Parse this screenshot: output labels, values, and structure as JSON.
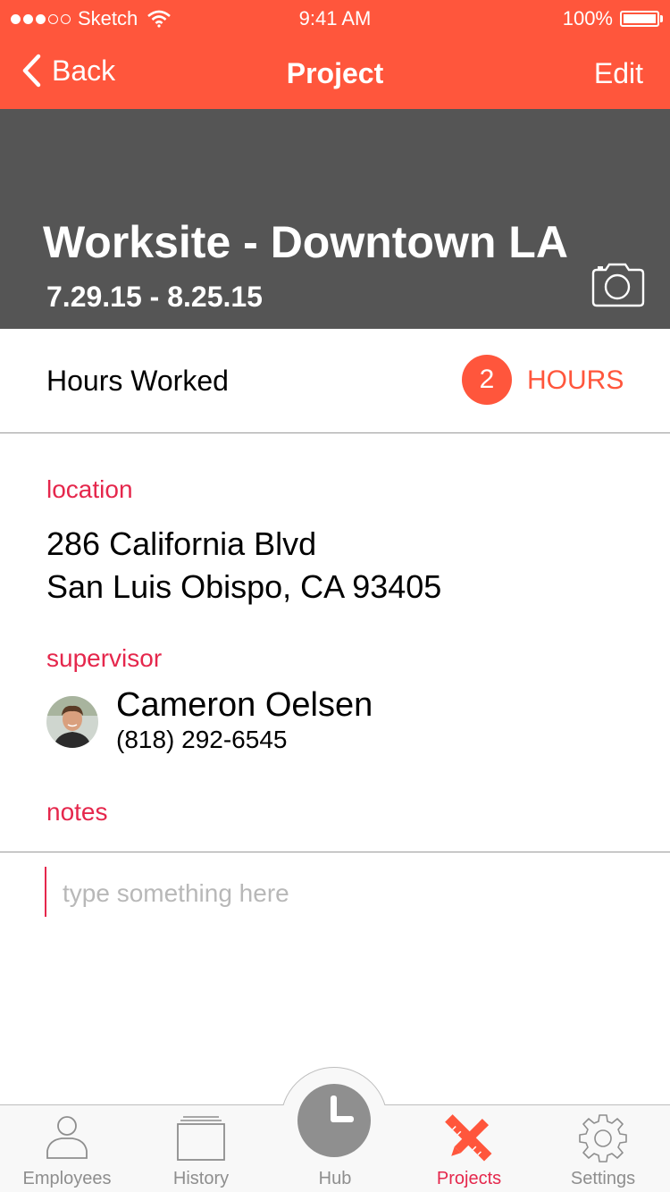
{
  "status_bar": {
    "carrier": "Sketch",
    "time": "9:41 AM",
    "battery": "100%"
  },
  "nav": {
    "back_label": "Back",
    "title": "Project",
    "edit_label": "Edit"
  },
  "project": {
    "title": "Worksite - Downtown LA",
    "dates": "7.29.15 - 8.25.15"
  },
  "hours": {
    "label": "Hours Worked",
    "count": "2",
    "unit": "HOURS"
  },
  "location": {
    "label": "location",
    "line1": "286 California Blvd",
    "line2": "San Luis Obispo, CA 93405"
  },
  "supervisor": {
    "label": "supervisor",
    "name": "Cameron Oelsen",
    "phone": "(818) 292-6545"
  },
  "notes": {
    "label": "notes",
    "placeholder": "type something here",
    "value": ""
  },
  "tabs": [
    {
      "label": "Employees",
      "icon": "person-icon",
      "active": false
    },
    {
      "label": "History",
      "icon": "stack-icon",
      "active": false
    },
    {
      "label": "Hub",
      "icon": "clock-icon",
      "active": false
    },
    {
      "label": "Projects",
      "icon": "tools-icon",
      "active": true
    },
    {
      "label": "Settings",
      "icon": "gear-icon",
      "active": false
    }
  ],
  "colors": {
    "accent": "#FF563C",
    "label_red": "#E5274C",
    "hero_bg": "#555555",
    "tab_inactive": "#8E8E8E"
  }
}
